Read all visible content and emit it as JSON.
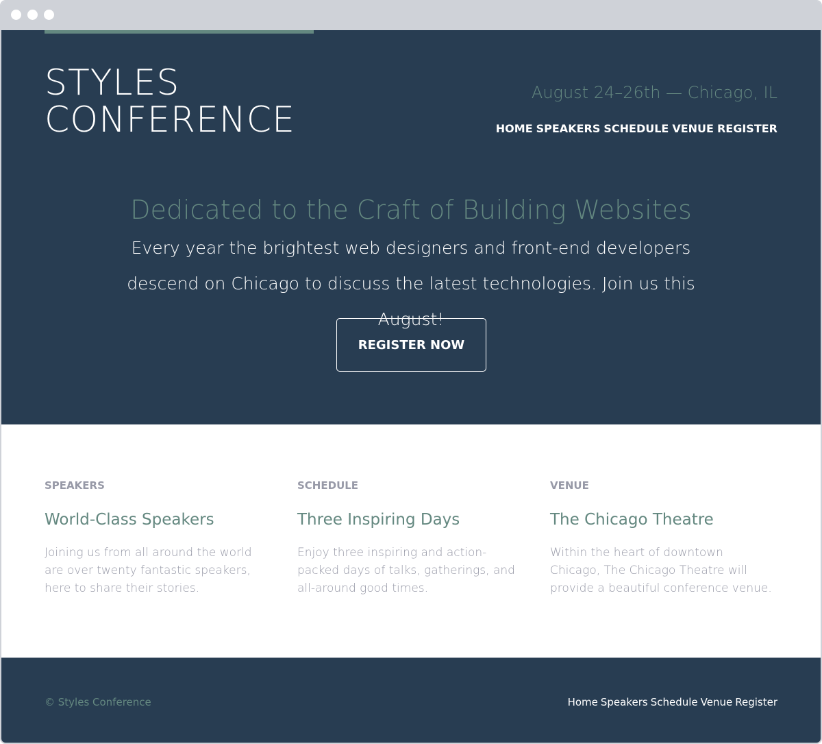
{
  "colors": {
    "navy": "#283d52",
    "sage": "#648880",
    "gray_text": "#9799a7",
    "white": "#ffffff",
    "chrome": "#cfd2d8"
  },
  "header": {
    "logo_line1": "STYLES",
    "logo_line2": "CONFERENCE",
    "tagline": "August 24–26th — Chicago, IL",
    "nav": [
      "HOME",
      "SPEAKERS",
      "SCHEDULE",
      "VENUE",
      "REGISTER"
    ]
  },
  "hero": {
    "title": "Dedicated to the Craft of Building Websites",
    "description": "Every year the brightest web designers and front-end developers descend on Chicago to discuss the latest technologies. Join us this August!",
    "cta_label": "REGISTER NOW"
  },
  "teasers": [
    {
      "eyebrow": "SPEAKERS",
      "title": "World-Class Speakers",
      "body": "Joining us from all around the world are over twenty fantastic speakers, here to share their stories."
    },
    {
      "eyebrow": "SCHEDULE",
      "title": "Three Inspiring Days",
      "body": "Enjoy three inspiring and action-packed days of talks, gatherings, and all-around good times."
    },
    {
      "eyebrow": "VENUE",
      "title": "The Chicago Theatre",
      "body": "Within the heart of downtown Chicago, The Chicago Theatre will provide a beautiful conference venue."
    }
  ],
  "footer": {
    "copyright": "© Styles Conference",
    "nav": [
      "Home",
      "Speakers",
      "Schedule",
      "Venue",
      "Register"
    ]
  }
}
